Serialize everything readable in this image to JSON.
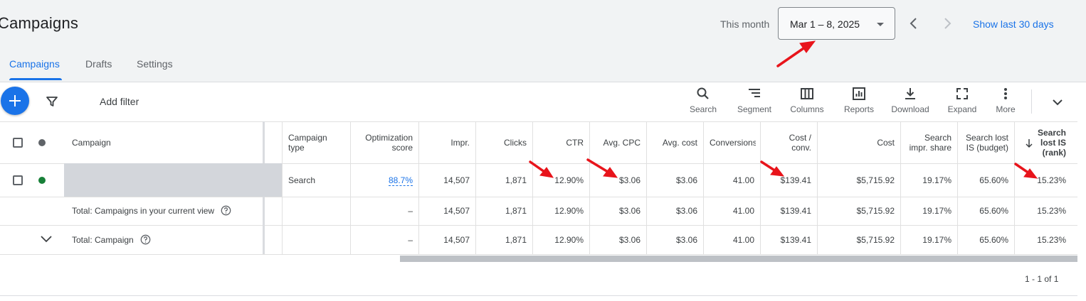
{
  "header": {
    "title": "Campaigns",
    "this_month_label": "This month",
    "date_range": "Mar 1 – 8, 2025",
    "show_last": "Show last 30 days"
  },
  "tabs": [
    {
      "label": "Campaigns",
      "active": true
    },
    {
      "label": "Drafts",
      "active": false
    },
    {
      "label": "Settings",
      "active": false
    }
  ],
  "toolbar": {
    "add_filter": "Add filter",
    "tools": [
      {
        "label": "Search",
        "icon": "search-icon"
      },
      {
        "label": "Segment",
        "icon": "segment-icon"
      },
      {
        "label": "Columns",
        "icon": "columns-icon"
      },
      {
        "label": "Reports",
        "icon": "reports-icon"
      },
      {
        "label": "Download",
        "icon": "download-icon"
      },
      {
        "label": "Expand",
        "icon": "expand-icon"
      },
      {
        "label": "More",
        "icon": "more-icon"
      }
    ]
  },
  "table": {
    "columns": {
      "campaign": "Campaign",
      "campaign_type": "Campaign type",
      "opt_score": "Optimization score",
      "impr": "Impr.",
      "clicks": "Clicks",
      "ctr": "CTR",
      "avg_cpc": "Avg. CPC",
      "avg_cost": "Avg. cost",
      "conversions": "Conversions",
      "cost_conv": "Cost / conv.",
      "cost": "Cost",
      "search_impr_share": "Search impr. share",
      "search_lost_budget": "Search lost IS (budget)",
      "search_lost_rank": "Search lost IS (rank)"
    },
    "row": {
      "campaign_type": "Search",
      "opt_score": "88.7%",
      "impr": "14,507",
      "clicks": "1,871",
      "ctr": "12.90%",
      "avg_cpc": "$3.06",
      "avg_cost": "$3.06",
      "conversions": "41.00",
      "cost_conv": "$139.41",
      "cost": "$5,715.92",
      "search_impr_share": "19.17%",
      "search_lost_budget": "65.60%",
      "search_lost_rank": "15.23%"
    },
    "total_view": {
      "label": "Total: Campaigns in your current view",
      "opt_score": "–",
      "impr": "14,507",
      "clicks": "1,871",
      "ctr": "12.90%",
      "avg_cpc": "$3.06",
      "avg_cost": "$3.06",
      "conversions": "41.00",
      "cost_conv": "$139.41",
      "cost": "$5,715.92",
      "search_impr_share": "19.17%",
      "search_lost_budget": "65.60%",
      "search_lost_rank": "15.23%"
    },
    "total_campaign": {
      "label": "Total: Campaign",
      "opt_score": "–",
      "impr": "14,507",
      "clicks": "1,871",
      "ctr": "12.90%",
      "avg_cpc": "$3.06",
      "avg_cost": "$3.06",
      "conversions": "41.00",
      "cost_conv": "$139.41",
      "cost": "$5,715.92",
      "search_impr_share": "19.17%",
      "search_lost_budget": "65.60%",
      "search_lost_rank": "15.23%"
    }
  },
  "pagination": "1 - 1 of 1",
  "colors": {
    "accent": "#1a73e8",
    "status_enabled": "#188038",
    "annotation": "#e8141b"
  }
}
